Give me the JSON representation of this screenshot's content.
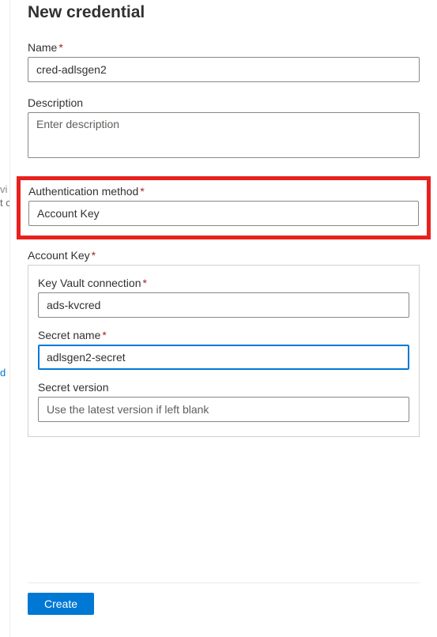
{
  "title": "New credential",
  "fields": {
    "name": {
      "label": "Name",
      "required": true,
      "value": "cred-adlsgen2"
    },
    "description": {
      "label": "Description",
      "required": false,
      "placeholder": "Enter description",
      "value": ""
    },
    "authMethod": {
      "label": "Authentication method",
      "required": true,
      "value": "Account Key"
    },
    "accountKeyGroup": {
      "label": "Account Key",
      "required": true
    },
    "kvConnection": {
      "label": "Key Vault connection",
      "required": true,
      "value": "ads-kvcred"
    },
    "secretName": {
      "label": "Secret name",
      "required": true,
      "value": "adlsgen2-secret"
    },
    "secretVersion": {
      "label": "Secret version",
      "required": false,
      "placeholder": "Use the latest version if left blank",
      "value": ""
    }
  },
  "buttons": {
    "create": "Create"
  },
  "leftSliver": {
    "top": "vi",
    "mid": "t c",
    "link": "d"
  }
}
